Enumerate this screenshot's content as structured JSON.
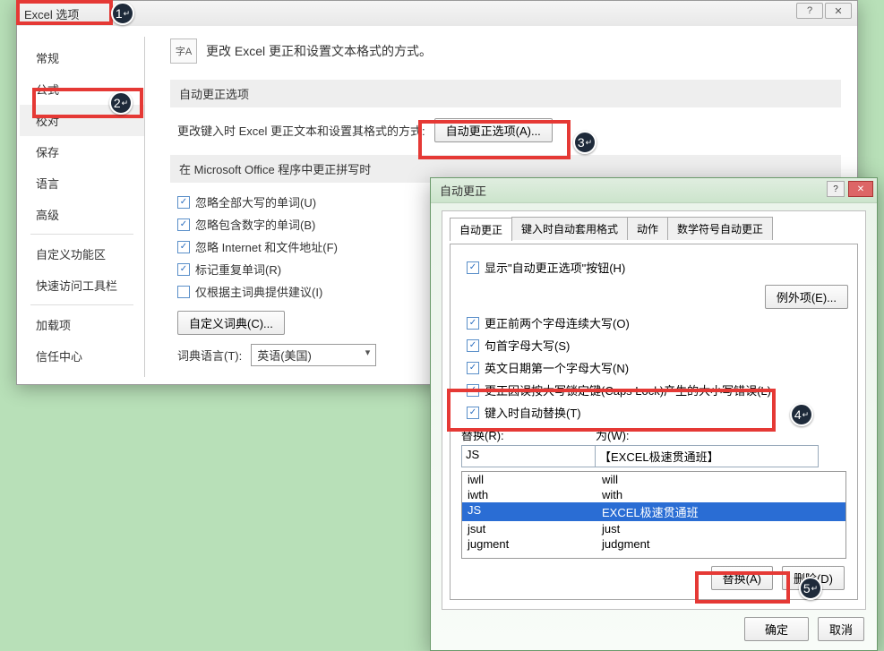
{
  "window": {
    "title": "Excel 选项"
  },
  "sidebar": {
    "items": [
      "常规",
      "公式",
      "校对",
      "保存",
      "语言",
      "高级"
    ],
    "items2": [
      "自定义功能区",
      "快速访问工具栏"
    ],
    "items3": [
      "加载项",
      "信任中心"
    ],
    "active_index": 2
  },
  "main": {
    "heading_icon": "字A",
    "heading": "更改 Excel 更正和设置文本格式的方式。",
    "section1_title": "自动更正选项",
    "section1_text": "更改键入时 Excel 更正文本和设置其格式的方式:",
    "autocorrect_button": "自动更正选项(A)...",
    "section2_title": "在 Microsoft Office 程序中更正拼写时",
    "checks": [
      {
        "label": "忽略全部大写的单词(U)",
        "checked": true
      },
      {
        "label": "忽略包含数字的单词(B)",
        "checked": true
      },
      {
        "label": "忽略 Internet 和文件地址(F)",
        "checked": true
      },
      {
        "label": "标记重复单词(R)",
        "checked": true
      },
      {
        "label": "仅根据主词典提供建议(I)",
        "checked": false
      }
    ],
    "custom_dict_button": "自定义词典(C)...",
    "dict_lang_label": "词典语言(T):",
    "dict_lang_value": "英语(美国)"
  },
  "autocorrect": {
    "title": "自动更正",
    "tabs": [
      "自动更正",
      "键入时自动套用格式",
      "动作",
      "数学符号自动更正"
    ],
    "active_tab": 0,
    "show_buttons_label": "显示\"自动更正选项\"按钮(H)",
    "checks": [
      "更正前两个字母连续大写(O)",
      "句首字母大写(S)",
      "英文日期第一个字母大写(N)",
      "更正因误按大写锁定键(Caps Lock)产生的大小写错误(L)",
      "键入时自动替换(T)"
    ],
    "exceptions_button": "例外项(E)...",
    "replace_label": "替换(R):",
    "with_label": "为(W):",
    "replace_value": "JS",
    "with_value": "【EXCEL极速贯通班】",
    "list": [
      {
        "from": "iwll",
        "to": "will"
      },
      {
        "from": "iwth",
        "to": "with"
      },
      {
        "from": "JS",
        "to": "EXCEL极速贯通班",
        "selected": true
      },
      {
        "from": "jsut",
        "to": "just"
      },
      {
        "from": "jugment",
        "to": "judgment"
      }
    ],
    "replace_button": "替换(A)",
    "delete_button": "删除(D)",
    "ok_button": "确定",
    "cancel_button": "取消"
  },
  "badges": [
    "1",
    "2",
    "3",
    "4",
    "5"
  ]
}
